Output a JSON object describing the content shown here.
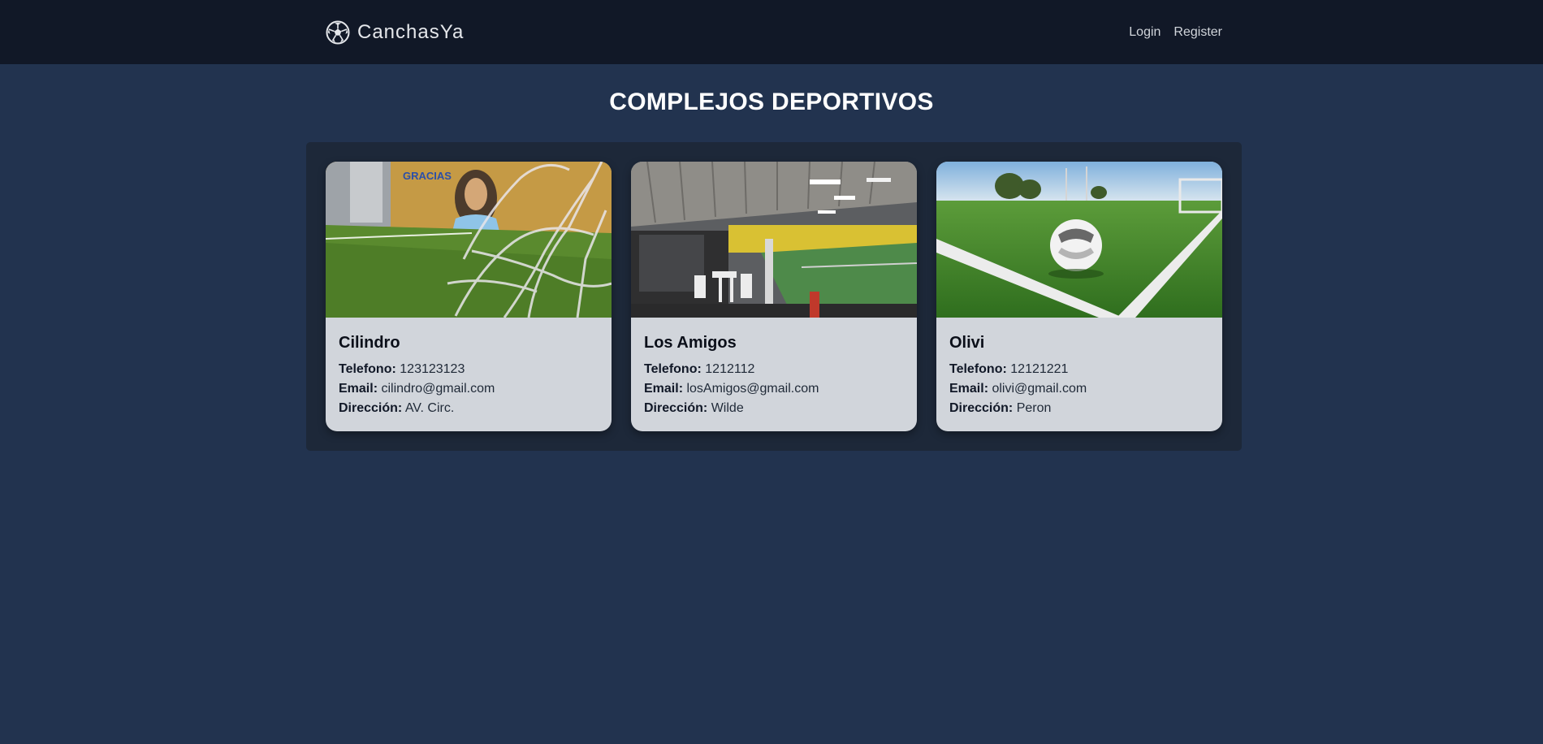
{
  "navbar": {
    "brand": "CanchasYa",
    "brand_icon": "soccer-ball-icon",
    "links": [
      "Login",
      "Register"
    ]
  },
  "page": {
    "title": "COMPLEJOS DEPORTIVOS"
  },
  "labels": {
    "phone": "Telefono:",
    "email": "Email:",
    "address": "Dirección:"
  },
  "complexes": [
    {
      "name": "Cilindro",
      "phone": "123123123",
      "email": "cilindro@gmail.com",
      "address": "AV. Circ.",
      "mural_text": "GRACIAS"
    },
    {
      "name": "Los Amigos",
      "phone": "1212112",
      "email": "losAmigos@gmail.com",
      "address": "Wilde"
    },
    {
      "name": "Olivi",
      "phone": "12121221",
      "email": "olivi@gmail.com",
      "address": "Peron"
    }
  ],
  "colors": {
    "background": "#22334f",
    "navbar": "#111827",
    "panel": "#1d2839",
    "card": "#d1d5db"
  }
}
